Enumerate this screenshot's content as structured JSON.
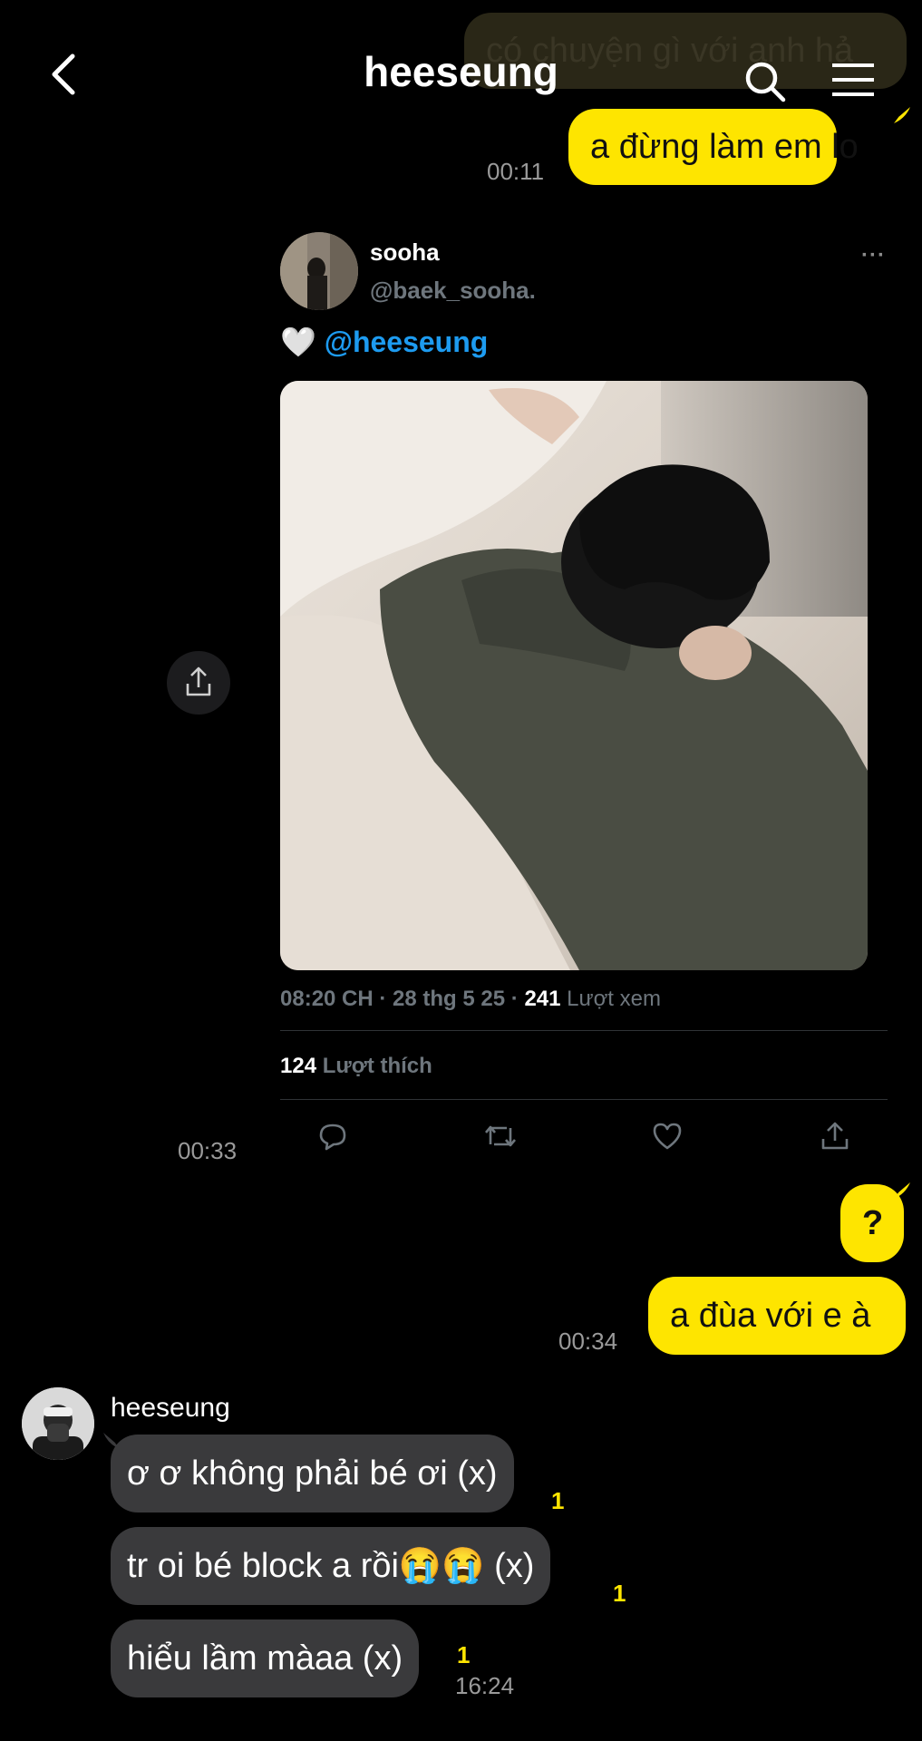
{
  "header": {
    "title": "heeseung",
    "icons": [
      "back-icon",
      "search-icon",
      "menu-icon"
    ]
  },
  "messages_top": {
    "faded_text": "có chuyện gì với anh hả",
    "msg1": "a đừng làm em lo",
    "msg1_time": "00:11"
  },
  "tweet": {
    "name": "sooha",
    "handle": "@baek_sooha.",
    "heart": "🤍",
    "mention": "@heeseung",
    "timestamp": "08:20 CH · 28 thg 5 25 ·",
    "views_count": "241",
    "views_label": "Lượt xem",
    "likes_count": "124",
    "likes_label": "Lượt thích",
    "more": "···",
    "time": "00:33"
  },
  "messages_mid": {
    "q": "?",
    "msg2": "a đùa với e à",
    "msg2_time": "00:34"
  },
  "incoming": {
    "sender": "heeseung",
    "msgs": [
      {
        "text": "ơ ơ không phải bé ơi (x)",
        "unread": "1"
      },
      {
        "text": "tr oi bé block a rồi😭😭 (x)",
        "unread": "1"
      },
      {
        "text": "hiểu lầm màaa (x)",
        "unread": "1"
      }
    ],
    "time": "16:24"
  },
  "colors": {
    "accent": "#FEE500",
    "bubble_them": "#3a3a3c",
    "link": "#1d9bf0"
  }
}
